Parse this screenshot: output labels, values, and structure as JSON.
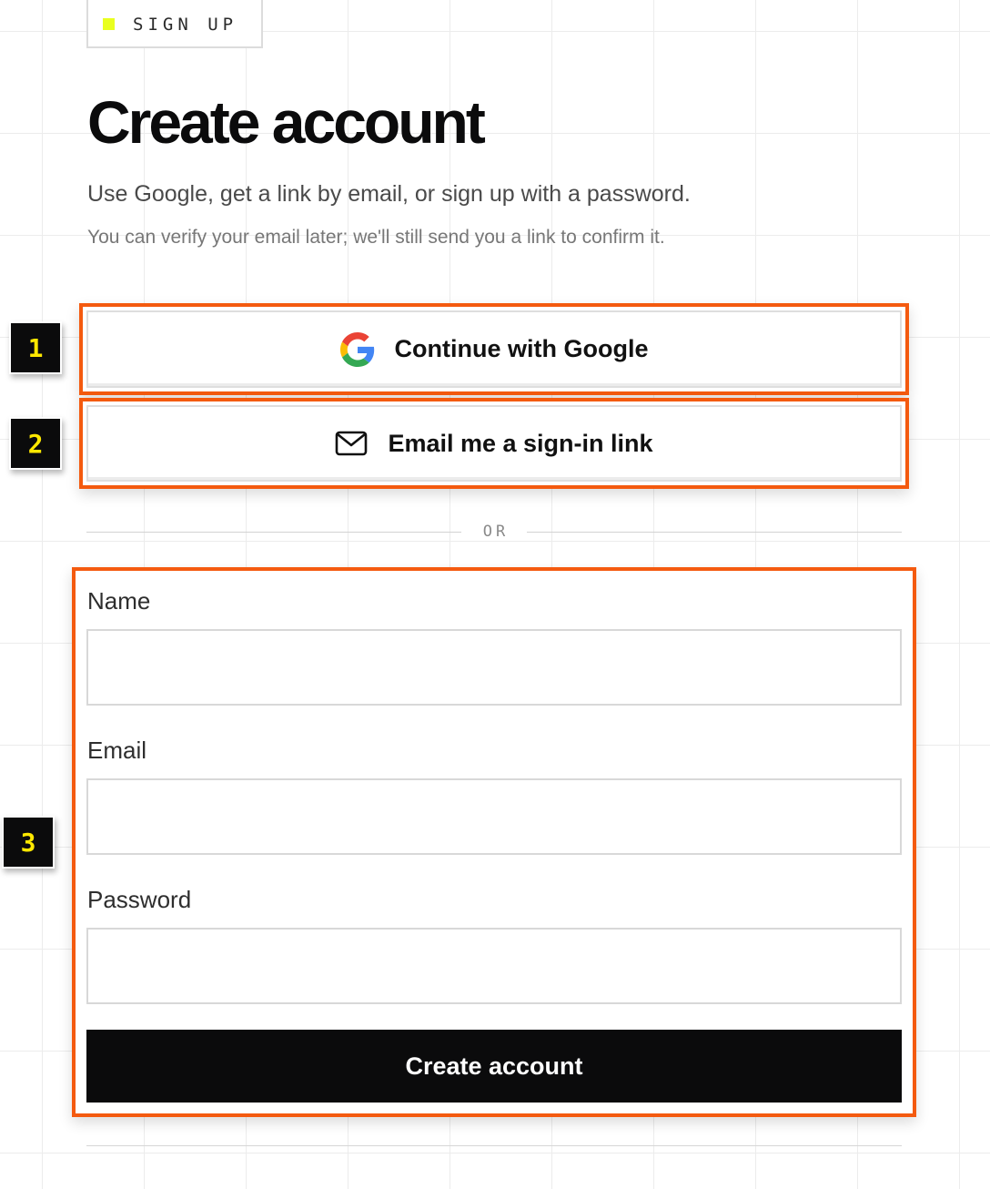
{
  "eyebrow": {
    "label": "SIGN UP",
    "accent_color": "#e9ff1f"
  },
  "header": {
    "title": "Create account",
    "subtitle": "Use Google, get a link by email, or sign up with a password.",
    "helper": "You can verify your email later; we'll still send you a link to confirm it."
  },
  "badges": {
    "one": "1",
    "two": "2",
    "three": "3",
    "background_color": "#0b0b0c",
    "text_color": "#ffe800"
  },
  "highlight": {
    "border_color": "#f45a0f"
  },
  "auth_options": {
    "google": {
      "label": "Continue with Google",
      "icon": "google-logo-icon"
    },
    "email_link": {
      "label": "Email me a sign-in link",
      "icon": "mail-envelope-icon"
    }
  },
  "divider": {
    "label": "OR"
  },
  "form": {
    "name": {
      "label": "Name",
      "value": "",
      "placeholder": ""
    },
    "email": {
      "label": "Email",
      "value": "",
      "placeholder": ""
    },
    "password": {
      "label": "Password",
      "value": "",
      "placeholder": ""
    },
    "submit_label": "Create account",
    "submit_color": "#0b0b0c"
  }
}
